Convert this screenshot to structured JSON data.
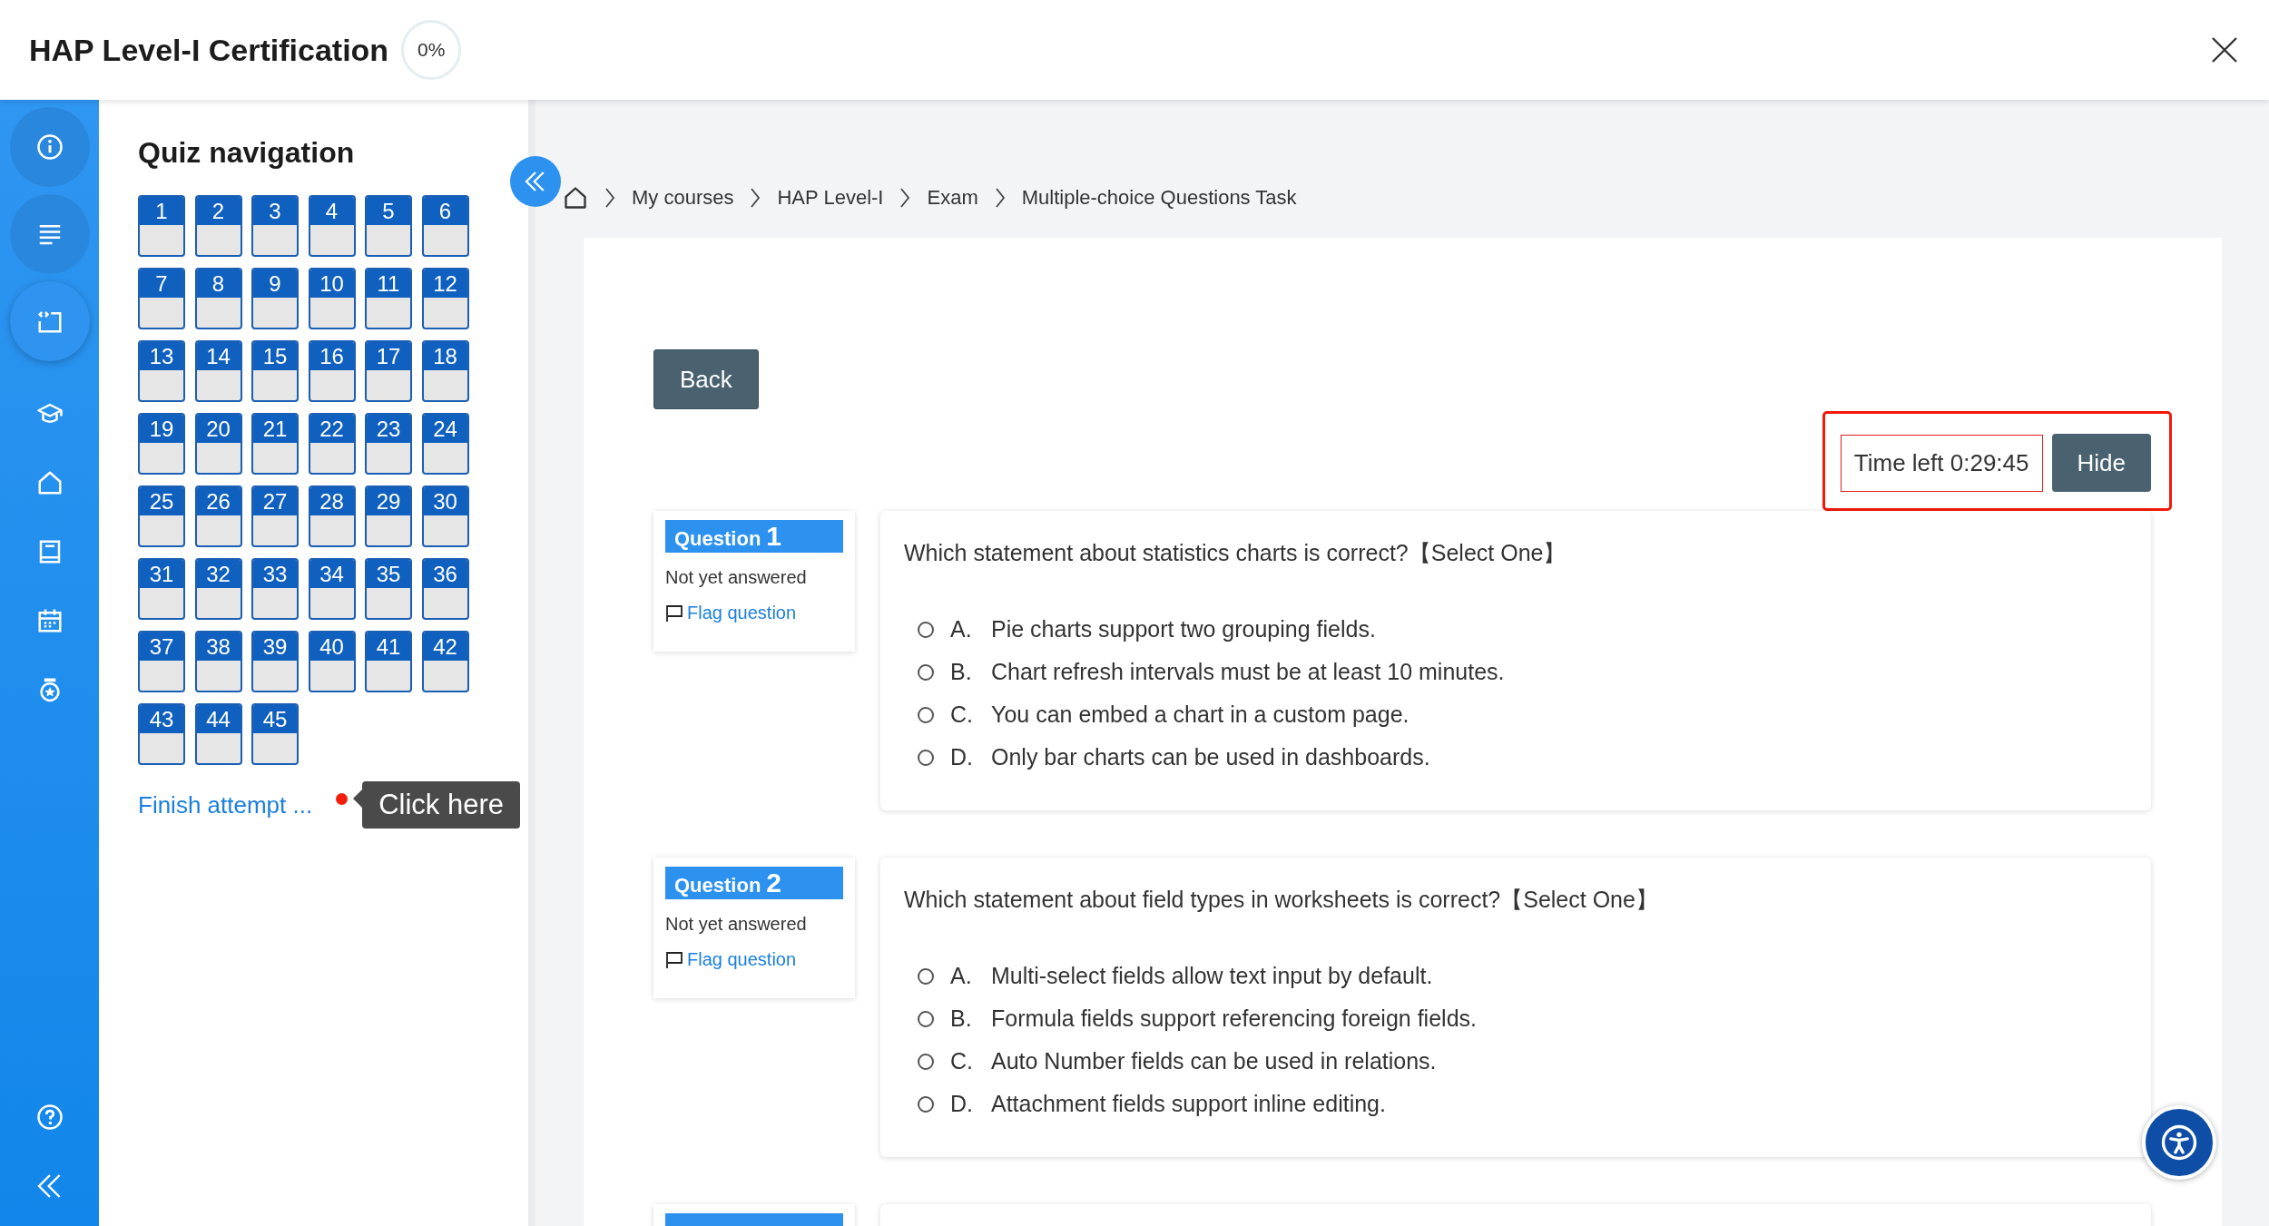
{
  "header": {
    "title": "HAP Level-I Certification",
    "progress": "0%"
  },
  "rail": {
    "items": [
      {
        "kind": "round",
        "selected": false
      },
      {
        "kind": "round",
        "selected": false
      },
      {
        "kind": "round",
        "selected": true
      },
      {
        "kind": "plain",
        "selected": false
      },
      {
        "kind": "plain",
        "selected": false
      },
      {
        "kind": "plain",
        "selected": false
      },
      {
        "kind": "plain",
        "selected": false
      },
      {
        "kind": "plain",
        "selected": false
      }
    ]
  },
  "quiz_navigation": {
    "title": "Quiz navigation",
    "questions": [
      "1",
      "2",
      "3",
      "4",
      "5",
      "6",
      "7",
      "8",
      "9",
      "10",
      "11",
      "12",
      "13",
      "14",
      "15",
      "16",
      "17",
      "18",
      "19",
      "20",
      "21",
      "22",
      "23",
      "24",
      "25",
      "26",
      "27",
      "28",
      "29",
      "30",
      "31",
      "32",
      "33",
      "34",
      "35",
      "36",
      "37",
      "38",
      "39",
      "40",
      "41",
      "42",
      "43",
      "44",
      "45"
    ],
    "finish_link": "Finish attempt ...",
    "tooltip": "Click here"
  },
  "breadcrumb": [
    "My courses",
    "HAP Level-I",
    "Exam",
    "Multiple-choice Questions Task"
  ],
  "back_button": "Back",
  "timer": {
    "text": "Time left 0:29:45",
    "hide_button": "Hide"
  },
  "questions": [
    {
      "label": "Question",
      "number": "1",
      "status": "Not yet answered",
      "flag": "Flag question",
      "text": "Which statement about statistics charts is correct?【Select One】",
      "options": [
        {
          "letter": "A.",
          "text": "Pie charts support two grouping fields.",
          "selected": false
        },
        {
          "letter": "B.",
          "text": "Chart refresh intervals must be at least 10 minutes.",
          "selected": false
        },
        {
          "letter": "C.",
          "text": "You can embed a chart in a custom page.",
          "selected": false
        },
        {
          "letter": "D.",
          "text": "Only bar charts can be used in dashboards.",
          "selected": false
        }
      ]
    },
    {
      "label": "Question",
      "number": "2",
      "status": "Not yet answered",
      "flag": "Flag question",
      "text": "Which statement about field types in worksheets is correct?【Select One】",
      "options": [
        {
          "letter": "A.",
          "text": "Multi-select fields allow text input by default.",
          "selected": false
        },
        {
          "letter": "B.",
          "text": "Formula fields support referencing foreign fields.",
          "selected": false
        },
        {
          "letter": "C.",
          "text": "Auto Number fields can be used in relations.",
          "selected": false
        },
        {
          "letter": "D.",
          "text": "Attachment fields support inline editing.",
          "selected": false
        }
      ]
    }
  ]
}
